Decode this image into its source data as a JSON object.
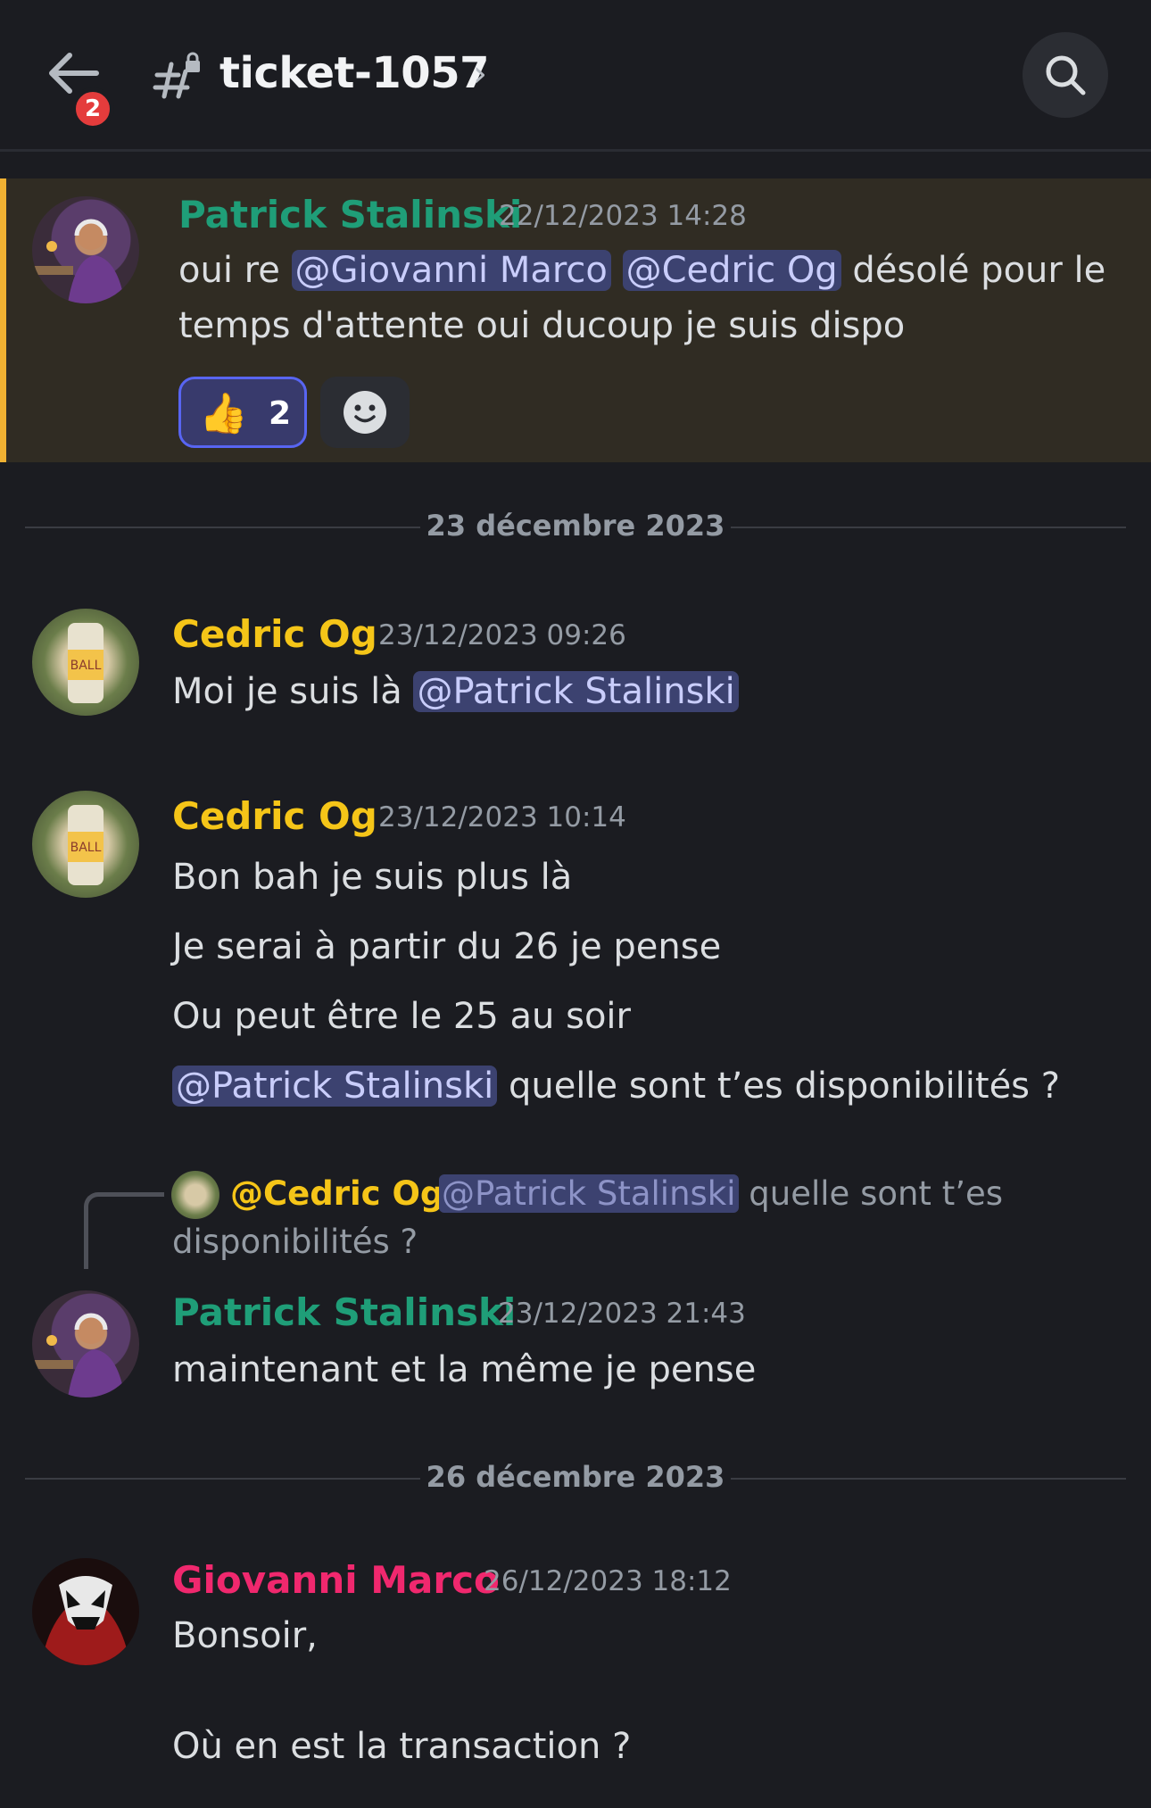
{
  "header": {
    "badge_count": "2",
    "channel_name": "ticket-1057",
    "chevron": "›"
  },
  "messages": [
    {
      "author": "Patrick Stalinski",
      "timestamp": "22/12/2023 14:28",
      "text_prefix": "oui re",
      "mention1": "@Giovanni Marco",
      "mention2": "@Cedric Og",
      "text_suffix": "désolé pour le",
      "line2": "temps d'attente oui ducoup je suis dispo",
      "reaction_emoji": "👍",
      "reaction_count": "2"
    },
    {
      "author": "Cedric Og",
      "timestamp": "23/12/2023 09:26",
      "text_prefix": "Moi je suis là",
      "mention": "@Patrick Stalinski"
    },
    {
      "author": "Cedric Og",
      "timestamp": "23/12/2023 10:14",
      "lines": [
        "Bon bah je suis plus là",
        "Je serai à partir du 26 je pense",
        "Ou peut être le 25 au soir"
      ],
      "mention": "@Patrick Stalinski",
      "text_suffix": "quelle sont t’es disponibilités ?"
    },
    {
      "reply": {
        "user": "@Cedric Og",
        "mention": "@Patrick Stalinski",
        "text": "quelle sont t’es",
        "text2": "disponibilités ?"
      },
      "author": "Patrick Stalinski",
      "timestamp": "23/12/2023 21:43",
      "text": "maintenant et la même je pense"
    },
    {
      "author": "Giovanni Marco",
      "timestamp": "26/12/2023 18:12",
      "line1": "Bonsoir,",
      "line2": "Où en est la transaction ?"
    }
  ],
  "dividers": [
    "23 décembre 2023",
    "26 décembre 2023"
  ],
  "colors": {
    "patrick": "#1f9e78",
    "cedric": "#f5c518",
    "giovanni": "#f0286e",
    "mention_bg": "#3c4270",
    "highlight_border": "#f0b132"
  }
}
